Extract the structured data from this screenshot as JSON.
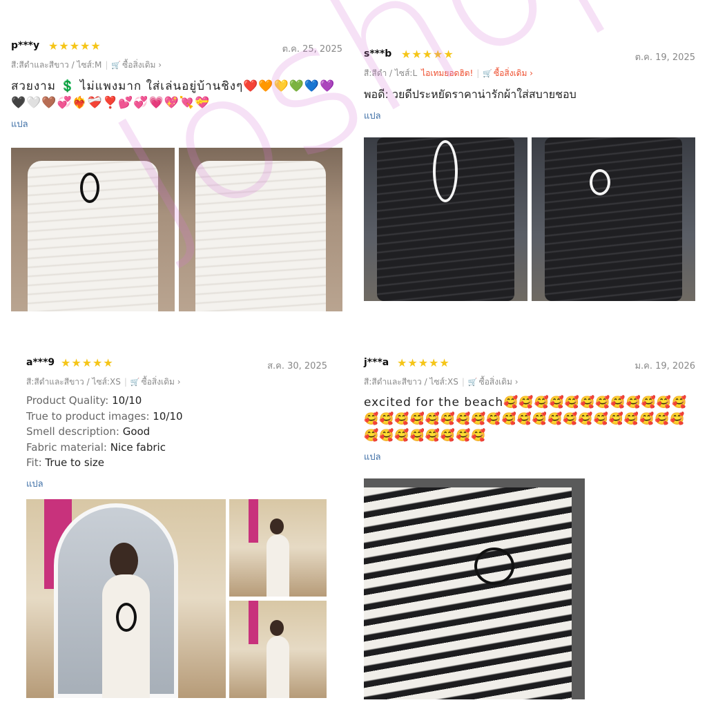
{
  "watermark": "Joshop",
  "reviews": [
    {
      "username": "p***y",
      "stars": "★★★★★",
      "date": "ต.ค. 25, 2025",
      "variation": "สี:สีดำและสีขาว / ไซส์:M",
      "rebuy": "ซื้อสิ่งเดิม",
      "text": "สวยงาม 💲 ไม่แพงมาก ใส่เล่นอยู่บ้านชิงๆ❤️🧡💛💚💙💜🖤🤍🤎💞❤️‍🔥❤️‍🩹❣️💕💞💗💖💘💝",
      "translate": "แปล"
    },
    {
      "username": "s***b",
      "stars": "★★★★★",
      "date": "ต.ค. 19, 2025",
      "variation": "สี:สีดำ / ไซส์:L",
      "hot_label": "ไอเทมยอดฮิต!",
      "rebuy": "ซื้อสิ่งเดิม",
      "text": "พอดี: วยดีประหยัดราคาน่ารักผ้าใส่สบายชอบ",
      "translate": "แปล"
    },
    {
      "username": "a***9",
      "stars": "★★★★★",
      "date": "ส.ค. 30, 2025",
      "variation": "สี:สีดำและสีขาว / ไซส์:XS",
      "rebuy": "ซื้อสิ่งเดิม",
      "attributes": [
        {
          "label": "Product Quality:",
          "value": "10/10"
        },
        {
          "label": "True to product images:",
          "value": "10/10"
        },
        {
          "label": "Smell description:",
          "value": "Good"
        },
        {
          "label": "Fabric material:",
          "value": "Nice fabric"
        },
        {
          "label": "Fit:",
          "value": "True to size"
        }
      ],
      "translate": "แปล"
    },
    {
      "username": "j***a",
      "stars": "★★★★★",
      "date": "ม.ค. 19, 2026",
      "variation": "สี:สีดำและสีขาว / ไซส์:XS",
      "rebuy": "ซื้อสิ่งเดิม",
      "text": "excited for the beach🥰🥰🥰🥰🥰🥰🥰🥰🥰🥰🥰🥰🥰🥰🥰🥰🥰🥰🥰🥰🥰🥰🥰🥰🥰🥰🥰🥰🥰🥰🥰🥰🥰🥰🥰🥰🥰🥰🥰🥰🥰",
      "translate": "แปล"
    }
  ],
  "colors": {
    "star": "#f5c518",
    "translate_link": "#3e6fa6",
    "hot": "#ee4d2d",
    "watermark": "#d778d7"
  }
}
